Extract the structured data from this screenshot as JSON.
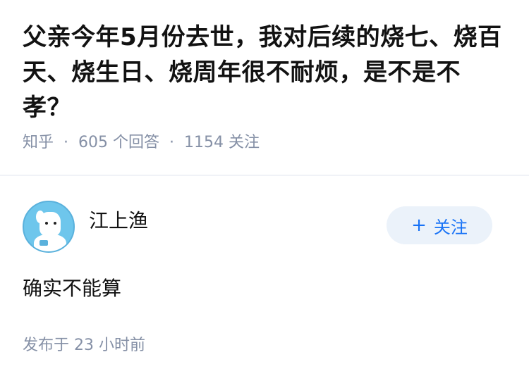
{
  "question": {
    "title": "父亲今年5月份去世，我对后续的烧七、烧百天、烧生日、烧周年很不耐烦，是不是不孝？",
    "source": "知乎",
    "answer_count": "605 个回答",
    "follower_count": "1154 关注"
  },
  "answer": {
    "author_name": "江上渔",
    "follow_label": "关注",
    "follow_plus": "+",
    "content": "确实不能算",
    "published": "发布于 23 小时前"
  },
  "colors": {
    "meta_gray": "#8590a6",
    "follow_blue": "#1772f6",
    "follow_bg": "#ebf2fa"
  },
  "icons": {
    "avatar": "cartoon-dog-avatar"
  }
}
